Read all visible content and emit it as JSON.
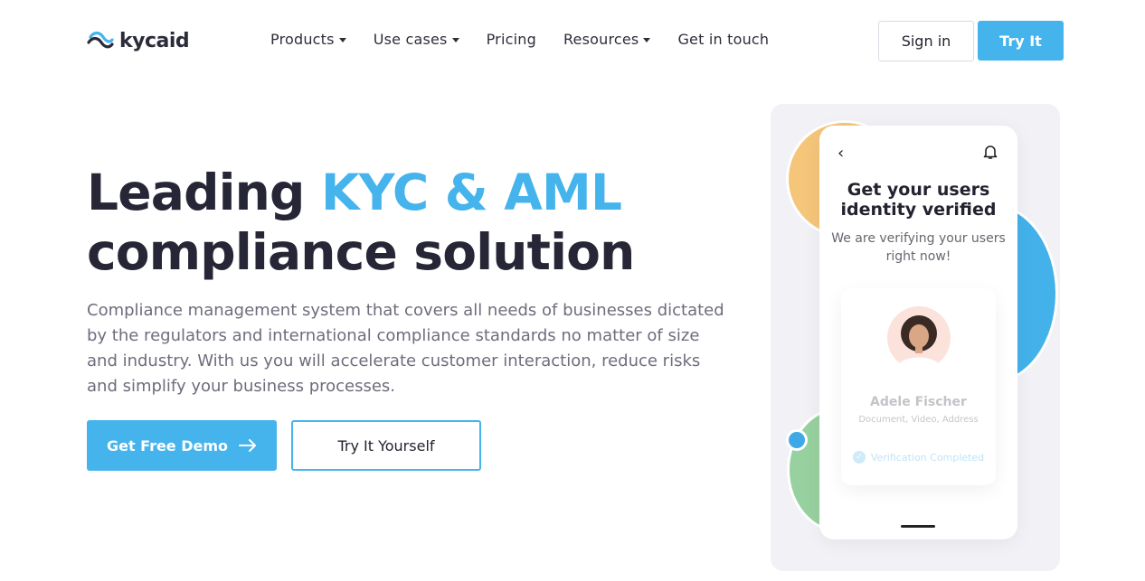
{
  "brand": {
    "name": "kycaid"
  },
  "nav": {
    "items": [
      {
        "label": "Products",
        "has_dropdown": true
      },
      {
        "label": "Use cases",
        "has_dropdown": true
      },
      {
        "label": "Pricing",
        "has_dropdown": false
      },
      {
        "label": "Resources",
        "has_dropdown": true
      },
      {
        "label": "Get in touch",
        "has_dropdown": false
      }
    ],
    "signin_label": "Sign in",
    "try_label": "Try It"
  },
  "hero": {
    "title_lead": "Leading ",
    "title_accent": "KYC & AML",
    "title_rest": "compliance solution",
    "description": "Compliance management system that covers all needs of businesses dictated by the regulators and international compliance standards no matter of size and industry. With us you will accelerate customer interaction, reduce risks and simplify your business processes.",
    "demo_label": "Get Free Demo",
    "yourself_label": "Try It Yourself"
  },
  "phone": {
    "title": "Get your users identity verified",
    "subtitle": "We are verifying your users right now!",
    "card": {
      "name": "Adele Fischer",
      "docs": "Document, Video, Address",
      "status": "Verification Completed"
    }
  },
  "colors": {
    "accent": "#45b3ec",
    "text_dark": "#262636",
    "text_muted": "#6d6d7d",
    "yellow": "#f5c57a",
    "green": "#98d1a0"
  }
}
